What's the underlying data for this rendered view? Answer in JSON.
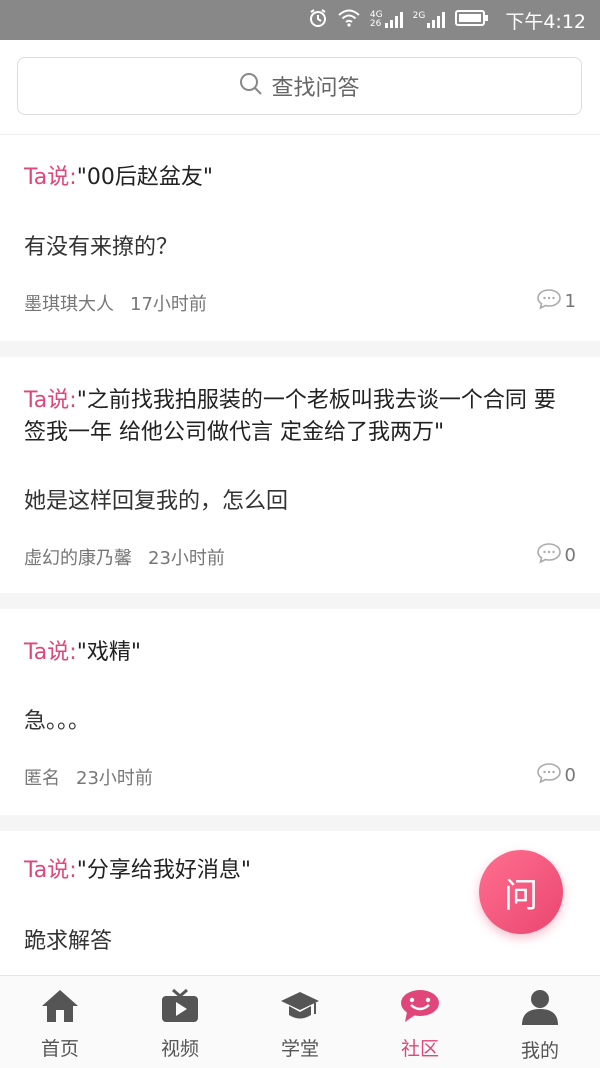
{
  "status_bar": {
    "time": "下午4:12",
    "net1": "4G",
    "net2": "26",
    "net3": "2G",
    "icons": [
      "alarm-icon",
      "wifi-icon",
      "signal-4g-icon",
      "signal-2g-icon",
      "battery-icon"
    ]
  },
  "search": {
    "placeholder": "查找问答",
    "icon": "search-icon"
  },
  "posts": [
    {
      "prefix": "Ta说:",
      "title": "\"00后赵盆友\"",
      "body": "有没有来撩的？",
      "author": "墨琪琪大人",
      "time": "17小时前",
      "comments": "1"
    },
    {
      "prefix": "Ta说:",
      "title": "\"之前找我拍服装的一个老板叫我去谈一个合同 要签我一年 给他公司做代言 定金给了我两万\"",
      "body": "她是这样回复我的，怎么回",
      "author": "虚幻的康乃馨",
      "time": "23小时前",
      "comments": "0"
    },
    {
      "prefix": "Ta说:",
      "title": "\"戏精\"",
      "body": "急。。。",
      "author": "匿名",
      "time": "23小时前",
      "comments": "0"
    },
    {
      "prefix": "Ta说:",
      "title": "\"分享给我好消息\"",
      "body": "跪求解答"
    }
  ],
  "fab": {
    "label": "问"
  },
  "tabs": [
    {
      "label": "首页",
      "icon": "home-icon"
    },
    {
      "label": "视频",
      "icon": "video-icon"
    },
    {
      "label": "学堂",
      "icon": "graduation-cap-icon"
    },
    {
      "label": "社区",
      "icon": "community-chat-icon",
      "active": true
    },
    {
      "label": "我的",
      "icon": "user-icon"
    }
  ],
  "colors": {
    "accent": "#e0467a",
    "status_bar": "#888888",
    "feed_bg": "#f5f5f5"
  }
}
